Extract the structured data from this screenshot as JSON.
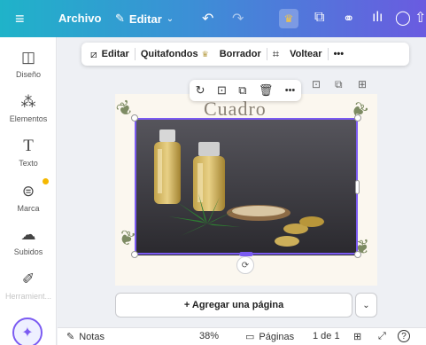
{
  "topbar": {
    "menu_icon": "hamburger-icon",
    "file_label": "Archivo",
    "edit_label": "Editar",
    "undo_icon": "undo-icon",
    "redo_icon": "redo-icon",
    "crown_icon": "crown-icon",
    "icons": [
      "copy-icon",
      "chart-people-icon",
      "bar-chart-icon",
      "comment-icon",
      "share-upload-icon"
    ]
  },
  "sidebar": {
    "items": [
      {
        "label": "Diseño",
        "icon": "layout-icon"
      },
      {
        "label": "Elementos",
        "icon": "shapes-icon"
      },
      {
        "label": "Texto",
        "icon": "text-icon"
      },
      {
        "label": "Marca",
        "icon": "brand-icon"
      },
      {
        "label": "Subidos",
        "icon": "upload-cloud-icon"
      },
      {
        "label": "Herramient...",
        "icon": "pen-tool-icon"
      }
    ],
    "magic_icon": "magic-sparkle-icon"
  },
  "context_toolbar": {
    "edit_label": "Editar",
    "bg_remover_label": "Quitafondos",
    "eraser_label": "Borrador",
    "flip_label": "Voltear",
    "more_label": "•••"
  },
  "page": {
    "title_text": "Cuadro"
  },
  "add_page_label": "+ Agregar una página",
  "bottombar": {
    "notes_label": "Notas",
    "zoom": "38%",
    "pages_label": "Páginas",
    "page_count": "1 de 1",
    "help_label": "?"
  }
}
